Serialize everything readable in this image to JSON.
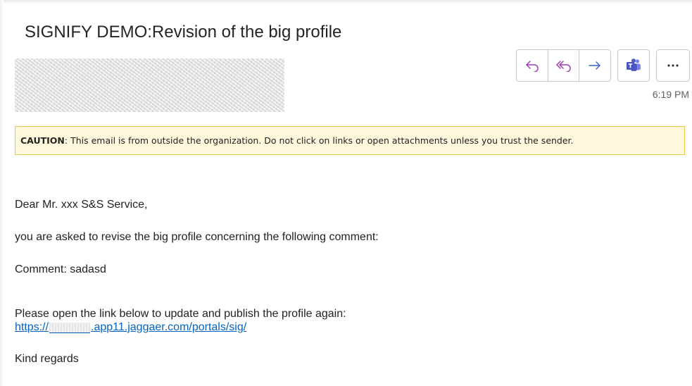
{
  "email": {
    "subject": "SIGNIFY DEMO:Revision of the big profile",
    "time": "6:19 PM",
    "caution": {
      "label": "CAUTION",
      "text": ": This email is from outside the organization. Do not click on links or open attachments unless you trust the sender."
    },
    "body": {
      "greeting": "Dear Mr. xxx S&S Service,",
      "line1": "you are asked to revise the big profile concerning the following comment:",
      "comment": "Comment: sadasd",
      "link_intro": "Please open the link below to update and publish the profile again:",
      "link_prefix": "https://",
      "link_suffix": ".app11.jaggaer.com/portals/sig/",
      "closing": "Kind regards"
    }
  },
  "actions": {
    "reply": {
      "icon": "reply-icon"
    },
    "reply_all": {
      "icon": "reply-all-icon"
    },
    "forward": {
      "icon": "forward-icon"
    },
    "teams": {
      "icon": "teams-icon"
    },
    "more": {
      "icon": "more-icon"
    }
  },
  "colors": {
    "accent": "#9b3fb5",
    "link": "#0563c1",
    "teams": "#5059c9",
    "caution_bg": "#fff8dc",
    "caution_border": "#e8c84a"
  }
}
